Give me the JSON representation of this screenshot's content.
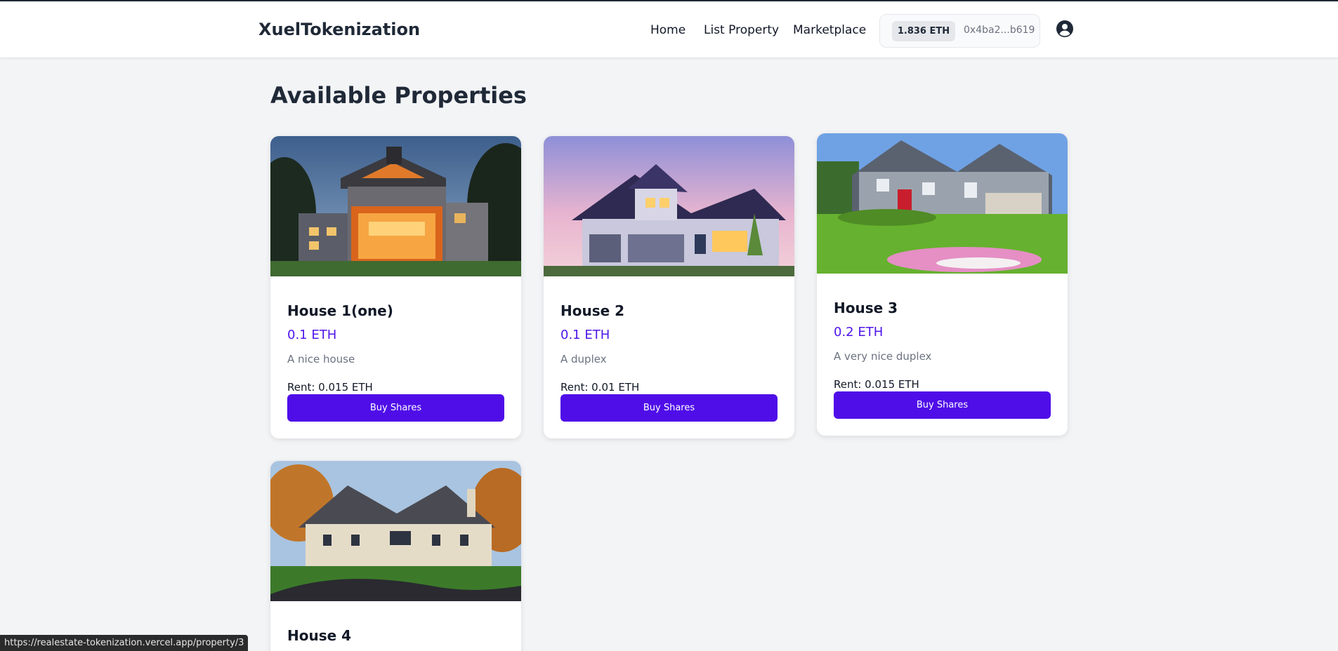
{
  "navbar": {
    "brand": "XuelTokenization",
    "links": [
      {
        "label": "Home"
      },
      {
        "label": "List Property"
      },
      {
        "label": "Marketplace"
      }
    ],
    "wallet": {
      "balance": "1.836 ETH",
      "address": "0x4ba2...b619"
    },
    "profile_icon": "user-circle-icon"
  },
  "main": {
    "title": "Available Properties",
    "properties": [
      {
        "title": "House 1(one)",
        "price": "0.1 ETH",
        "description": "A nice house",
        "rent": "Rent: 0.015 ETH",
        "button": "Buy Shares"
      },
      {
        "title": "House 2",
        "price": "0.1 ETH",
        "description": "A duplex",
        "rent": "Rent: 0.01 ETH",
        "button": "Buy Shares"
      },
      {
        "title": "House 3",
        "price": "0.2 ETH",
        "description": "A very nice duplex",
        "rent": "Rent: 0.015 ETH",
        "button": "Buy Shares"
      },
      {
        "title": "House 4"
      }
    ]
  },
  "status_bar": {
    "url": "https://realestate-tokenization.vercel.app/property/3"
  },
  "colors": {
    "accent": "#4f0ee8",
    "price": "#4f16ea",
    "background": "#f3f4f6"
  }
}
